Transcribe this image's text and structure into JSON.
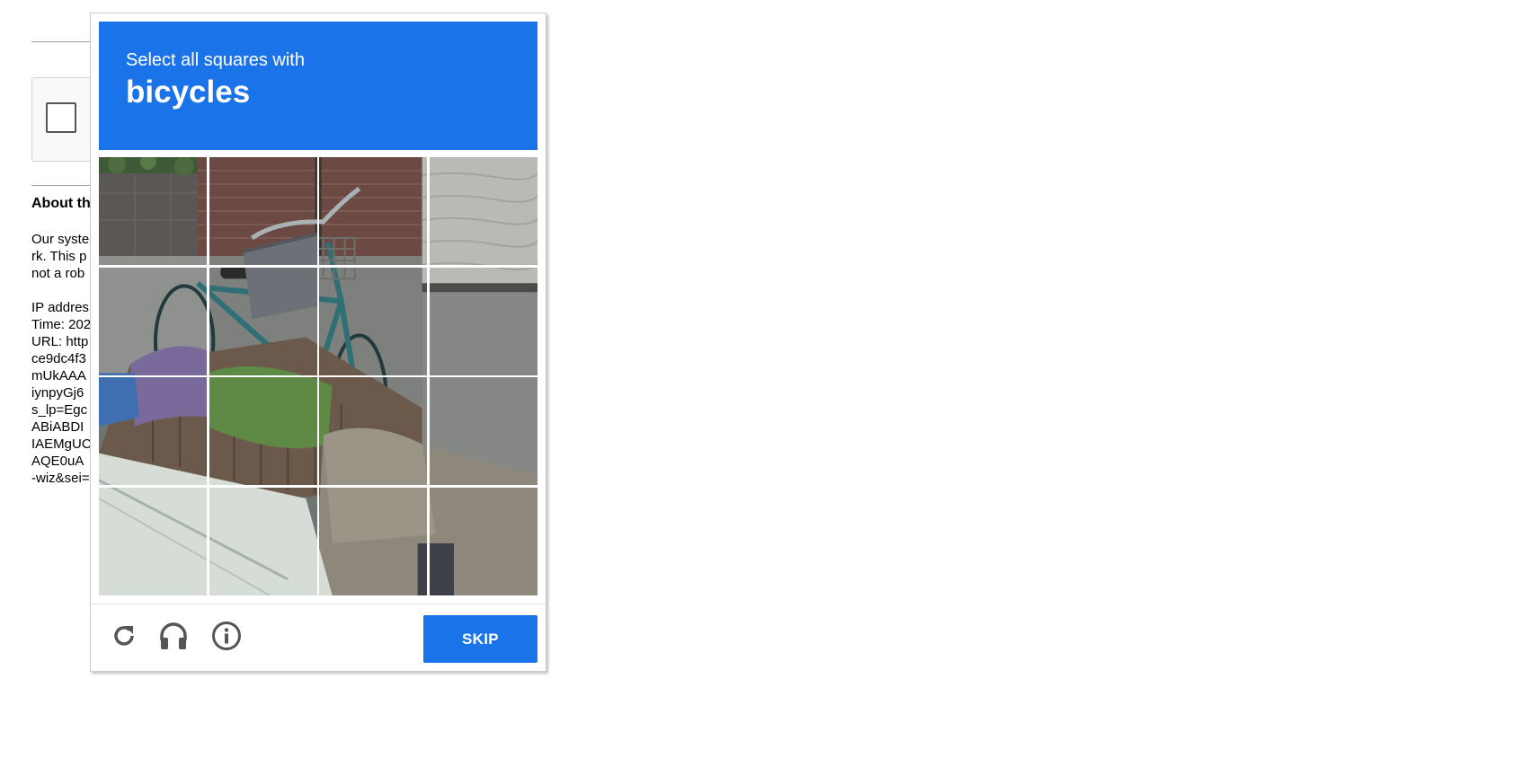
{
  "background_page": {
    "heading": "About th",
    "paragraph_lines": [
      "Our syste",
      "rk. This p",
      "not a rob"
    ],
    "info_lines": [
      "IP addres",
      "Time: 202",
      "URL: http",
      "ce9dc4f3",
      "mUkAAA",
      "iynpyGj6",
      "s_lp=Egc",
      "ABiABDI",
      "IAEMgUC",
      "AQE0uA",
      "-wiz&sei="
    ]
  },
  "challenge": {
    "instruction": "Select all squares with",
    "target": "bicycles",
    "grid": {
      "rows": 4,
      "columns": 4
    },
    "footer": {
      "reload_icon": "reload-icon",
      "audio_icon": "headphones-icon",
      "info_icon": "info-icon",
      "skip_label": "SKIP"
    },
    "colors": {
      "header": "#1a73e8",
      "button": "#1a73e8",
      "icons": "#555555"
    }
  }
}
